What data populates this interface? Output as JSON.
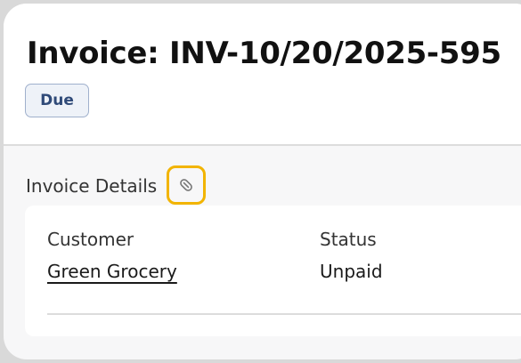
{
  "invoice": {
    "title": "Invoice: INV-10/20/2025-595",
    "badge": "Due"
  },
  "section": {
    "label": "Invoice Details",
    "attach_icon": "paperclip-icon"
  },
  "details": {
    "customer_label": "Customer",
    "customer_value": "Green Grocery",
    "status_label": "Status",
    "status_value": "Unpaid"
  },
  "colors": {
    "badge_border": "#9fb0cc",
    "badge_text": "#2f4a78",
    "focus_ring": "#f2b400"
  }
}
